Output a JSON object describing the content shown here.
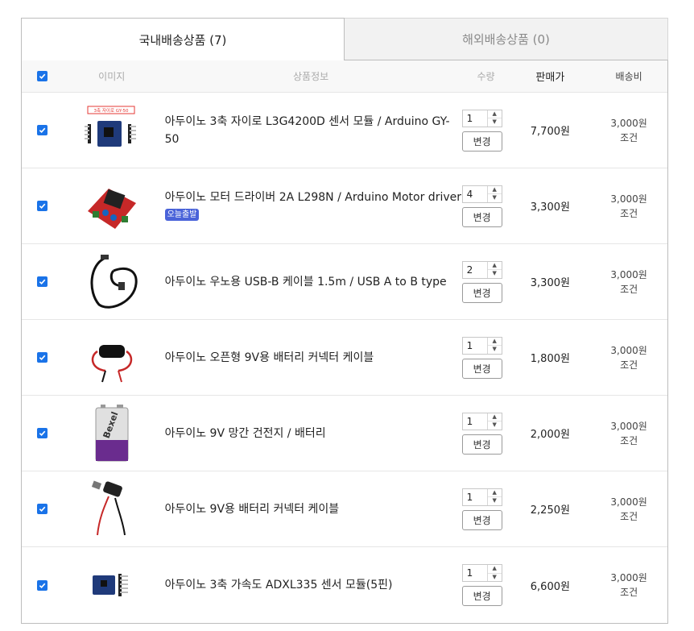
{
  "tabs": {
    "domestic": "국내배송상품 (7)",
    "overseas": "해외배송상품 (0)"
  },
  "header": {
    "image": "이미지",
    "info": "상품정보",
    "qty": "수량",
    "price": "판매가",
    "shipping": "배송비"
  },
  "change_label": "변경",
  "items": [
    {
      "name": "아두이노 3축 자이로 L3G4200D 센서 모듈 / Arduino GY-50",
      "qty": "1",
      "price": "7,700원",
      "ship_fee": "3,000원",
      "ship_cond": "조건",
      "thumb_label": "3축 자이로 GY-50"
    },
    {
      "name": "아두이노 모터 드라이버 2A L298N / Arduino Motor driver",
      "badge": "오늘출발",
      "qty": "4",
      "price": "3,300원",
      "ship_fee": "3,000원",
      "ship_cond": "조건"
    },
    {
      "name": "아두이노 우노용 USB-B 케이블 1.5m / USB A to B type",
      "qty": "2",
      "price": "3,300원",
      "ship_fee": "3,000원",
      "ship_cond": "조건"
    },
    {
      "name": "아두이노 오픈형 9V용 배터리 커넥터 케이블",
      "qty": "1",
      "price": "1,800원",
      "ship_fee": "3,000원",
      "ship_cond": "조건"
    },
    {
      "name": "아두이노 9V 망간 건전지 / 배터리",
      "qty": "1",
      "price": "2,000원",
      "ship_fee": "3,000원",
      "ship_cond": "조건",
      "thumb_label": "Bexel"
    },
    {
      "name": "아두이노 9V용 배터리 커넥터 케이블",
      "qty": "1",
      "price": "2,250원",
      "ship_fee": "3,000원",
      "ship_cond": "조건"
    },
    {
      "name": "아두이노 3축 가속도 ADXL335 센서 모듈(5핀)",
      "qty": "1",
      "price": "6,600원",
      "ship_fee": "3,000원",
      "ship_cond": "조건"
    }
  ],
  "colors": {
    "checkbox": "#1a73e8",
    "badge": "#4a63d9"
  },
  "icons": {
    "checkbox": "checkmark-icon",
    "stepper_up": "caret-up-icon",
    "stepper_down": "caret-down-icon"
  }
}
